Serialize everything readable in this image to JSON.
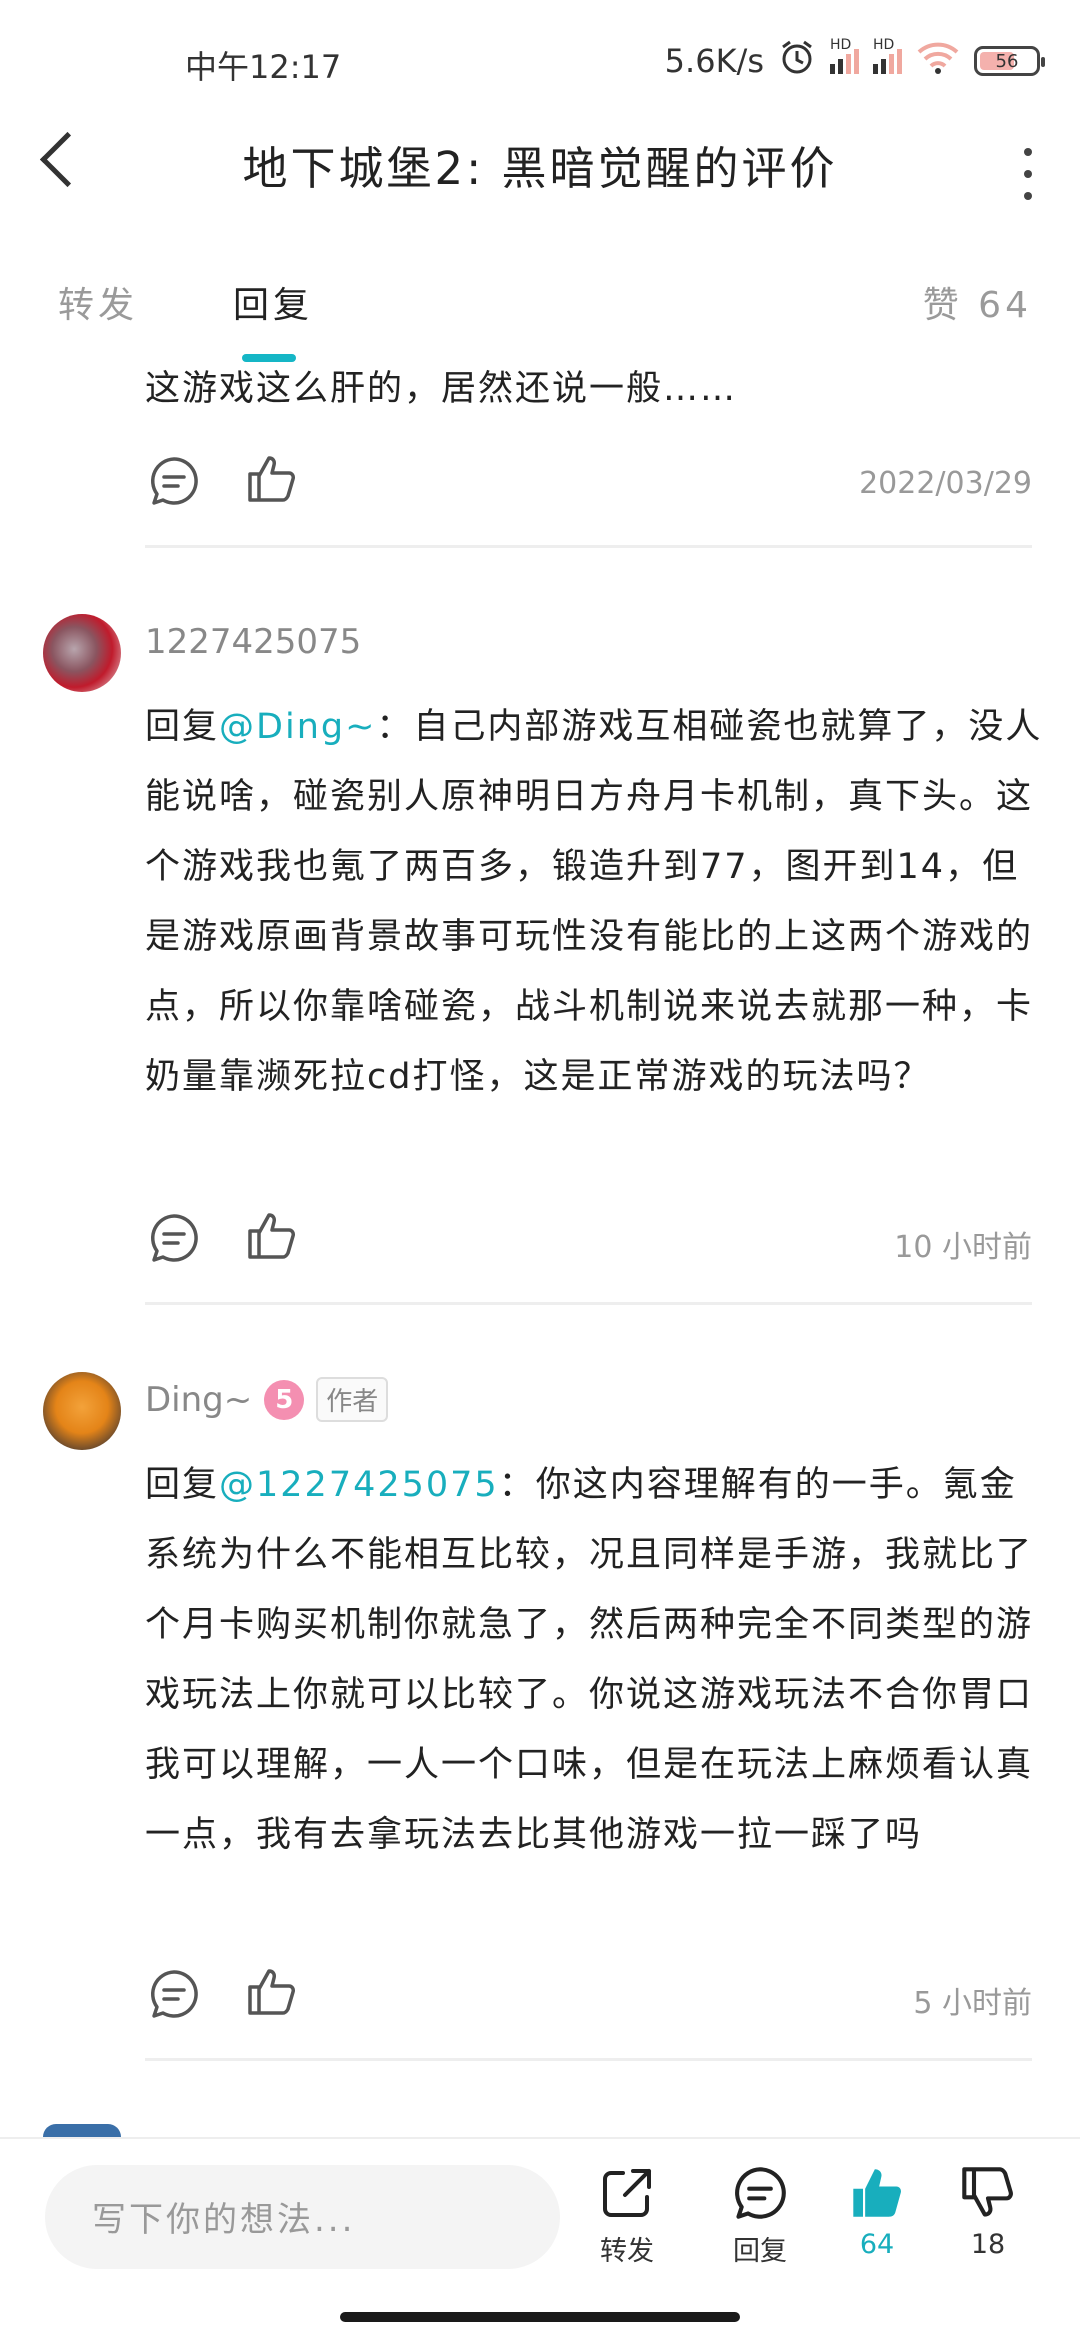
{
  "status_bar": {
    "time": "中午12:17",
    "speed": "5.6K/s",
    "signal1": "HD",
    "signal2": "HD",
    "battery": "56"
  },
  "header": {
    "title": "地下城堡2: 黑暗觉醒的评价"
  },
  "tabs": {
    "forward": "转发",
    "reply": "回复",
    "likes": "赞 64"
  },
  "comments": [
    {
      "text": "这游戏这么肝的，居然还说一般……",
      "time": "2022/03/29"
    },
    {
      "user": "1227425075",
      "reply_prefix": "回复",
      "mention": "@Ding~",
      "text": "：自己内部游戏互相碰瓷也就算了，没人能说啥，碰瓷别人原神明日方舟月卡机制，真下头。这个游戏我也氪了两百多，锻造升到77，图开到14，但是游戏原画背景故事可玩性没有能比的上这两个游戏的点，所以你靠啥碰瓷，战斗机制说来说去就那一种，卡奶量靠濒死拉cd打怪，这是正常游戏的玩法吗？",
      "time": "10 小时前"
    },
    {
      "user": "Ding~",
      "level": "5",
      "badge": "作者",
      "reply_prefix": "回复",
      "mention": "@1227425075",
      "text": "：你这内容理解有的一手。氪金系统为什么不能相互比较，况且同样是手游，我就比了个月卡购买机制你就急了，然后两种完全不同类型的游戏玩法上你就可以比较了。你说这游戏玩法不合你胃口我可以理解，一人一个口味，但是在玩法上麻烦看认真一点，我有去拿玩法去比其他游戏一拉一踩了吗",
      "time": "5 小时前"
    }
  ],
  "bottom_bar": {
    "input_placeholder": "写下你的想法...",
    "forward": "转发",
    "reply": "回复",
    "like_count": "64",
    "dislike_count": "18"
  },
  "colors": {
    "accent": "#18aebd",
    "text": "#222222",
    "muted": "#999999"
  }
}
